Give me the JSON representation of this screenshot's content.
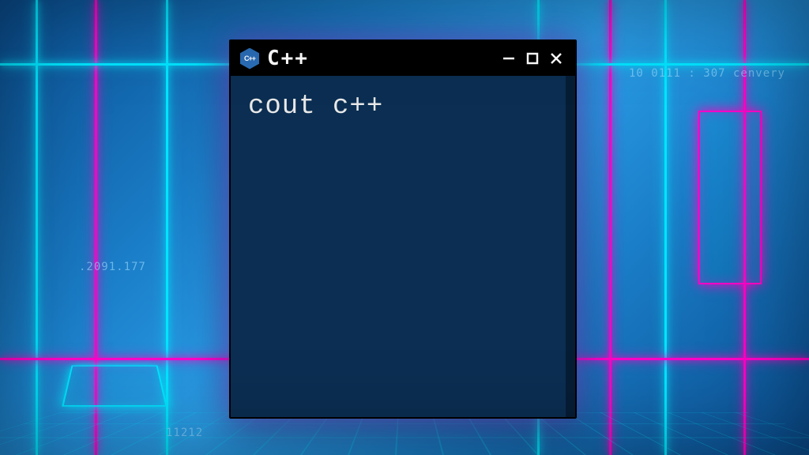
{
  "window": {
    "title": "C++",
    "icon_name": "cpp-hexagon-icon",
    "icon_text": "C++"
  },
  "terminal": {
    "content": "cout c++"
  },
  "background": {
    "decorative_text_1": "10 0111 : 307  cenvery",
    "decorative_text_2": ".2091.177",
    "decorative_text_3": "11212"
  },
  "colors": {
    "terminal_bg": "#0b2e52",
    "titlebar_bg": "#000000",
    "neon_cyan": "#00e5ff",
    "neon_magenta": "#ff00c8",
    "text_color": "#e8e8e8"
  }
}
